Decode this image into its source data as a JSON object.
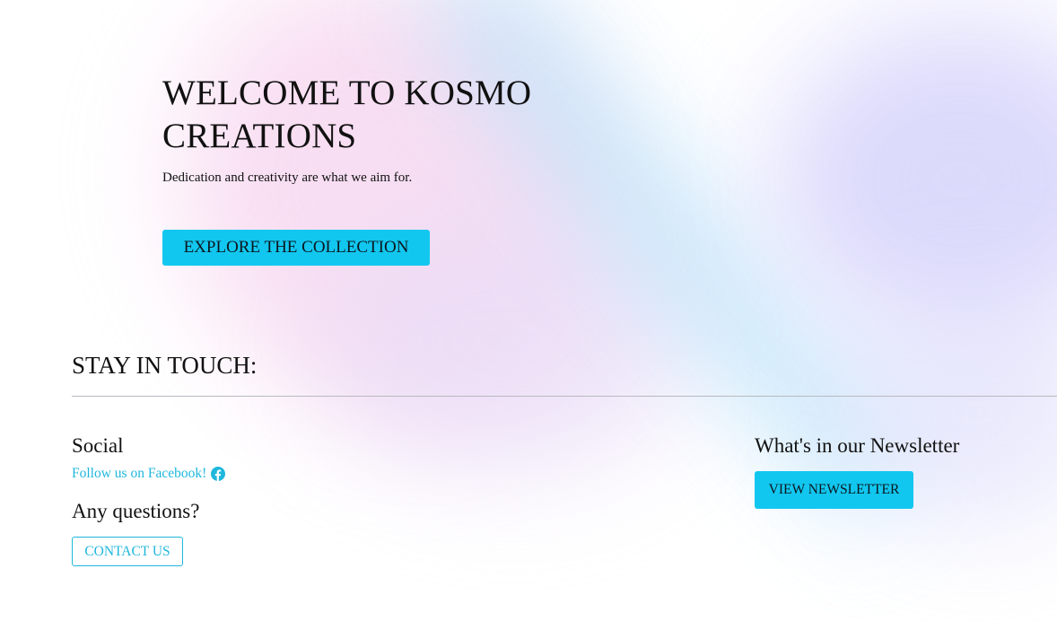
{
  "hero": {
    "title": "WELCOME TO KOSMO CREATIONS",
    "tagline": "Dedication and creativity are what we aim for.",
    "explore_label": "EXPLORE THE COLLECTION"
  },
  "stay_in_touch": {
    "title": "STAY IN TOUCH:"
  },
  "social": {
    "heading": "Social",
    "facebook_link": "Follow us on Facebook!",
    "facebook_icon": "facebook-icon"
  },
  "questions": {
    "heading": "Any questions?",
    "contact_label": "CONTACT US"
  },
  "newsletter": {
    "heading": "What's in our Newsletter",
    "button_label": "VIEW NEWSLETTER"
  },
  "colors": {
    "accent": "#12c7ef",
    "link": "#1fb7dc",
    "divider": "#b9b9c0"
  }
}
